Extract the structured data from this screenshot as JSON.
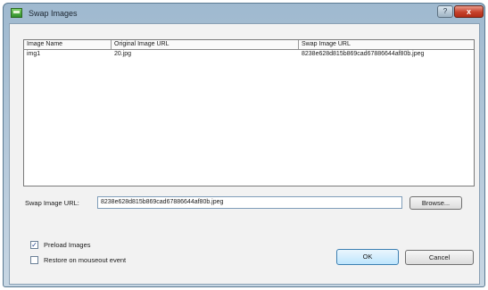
{
  "window": {
    "title": "Swap Images",
    "help_label": "?",
    "close_label": "x"
  },
  "table": {
    "columns": [
      "Image Name",
      "Original Image URL",
      "Swap Image URL"
    ],
    "rows": [
      [
        "img1",
        "20.jpg",
        "8238e628d815b869cad67886644af80b.jpeg"
      ]
    ]
  },
  "swap_url": {
    "label": "Swap Image URL:",
    "value": "8238e628d815b869cad67886644af80b.jpeg",
    "browse_label": "Browse..."
  },
  "options": {
    "preload": {
      "label": "Preload Images",
      "checked": true,
      "mark": "✓"
    },
    "restore": {
      "label": "Restore on mouseout event",
      "checked": false,
      "mark": ""
    }
  },
  "buttons": {
    "ok": "OK",
    "cancel": "Cancel"
  }
}
